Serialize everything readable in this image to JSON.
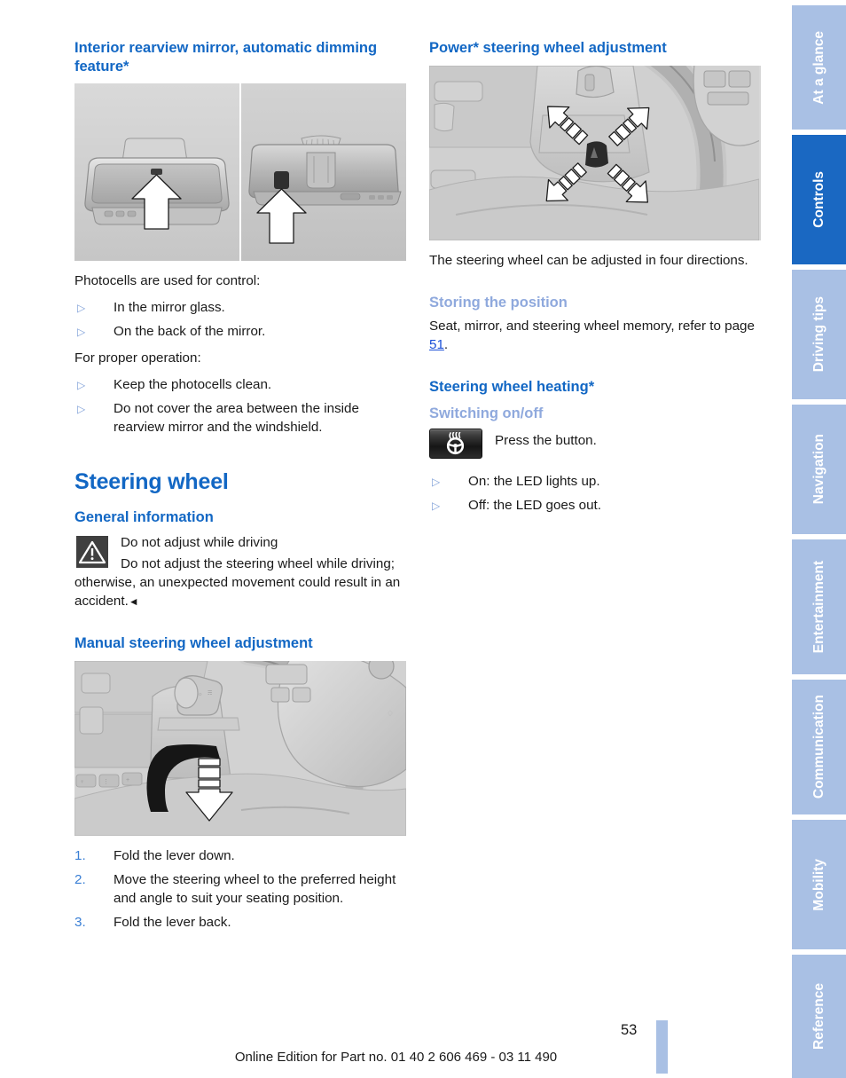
{
  "left_column": {
    "heading": "Interior rearview mirror, automatic dimming feature*",
    "figure_mirror": {
      "name": "interior-rearview-mirror-photocells",
      "caption": ""
    },
    "intro_1": "Photocells are used for control:",
    "bullets_1": [
      "In the mirror glass.",
      "On the back of the mirror."
    ],
    "intro_2": "For proper operation:",
    "bullets_2": [
      "Keep the photocells clean.",
      "Do not cover the area between the inside rearview mirror and the windshield."
    ],
    "section_title": "Steering wheel",
    "general_information_title": "General information",
    "warning": {
      "icon": "warning-triangle-icon",
      "title": "Do not adjust while driving",
      "body": "Do not adjust the steering wheel while driving; otherwise, an unexpected movement could result in an accident.",
      "end_mark": "◄"
    },
    "manual_adjustment_title": "Manual steering wheel adjustment",
    "figure_manual": {
      "name": "manual-steering-wheel-lever"
    },
    "steps": [
      {
        "num": "1.",
        "text": "Fold the lever down."
      },
      {
        "num": "2.",
        "text": "Move the steering wheel to the preferred height and angle to suit your seating posi­tion."
      },
      {
        "num": "3.",
        "text": "Fold the lever back."
      }
    ]
  },
  "right_column": {
    "heading": "Power* steering wheel adjustment",
    "figure_power": {
      "name": "power-steering-wheel-switch"
    },
    "paragraph_1": "The steering wheel can be adjusted in four di­rections.",
    "storing_title": "Storing the position",
    "storing_text_before": "Seat, mirror, and steering wheel memory, refer to page ",
    "storing_page_ref": "51",
    "storing_text_after": ".",
    "heating_title": "Steering wheel heating*",
    "switching_title": "Switching on/off",
    "button": {
      "icon": "steering-wheel-heating-icon",
      "caption": "Press the button."
    },
    "heating_bullets": [
      "On: the LED lights up.",
      "Off: the LED goes out."
    ]
  },
  "tabs": [
    {
      "label": "At a glance",
      "active": false
    },
    {
      "label": "Controls",
      "active": true
    },
    {
      "label": "Driving tips",
      "active": false
    },
    {
      "label": "Navigation",
      "active": false
    },
    {
      "label": "Entertainment",
      "active": false
    },
    {
      "label": "Communication",
      "active": false
    },
    {
      "label": "Mobility",
      "active": false
    },
    {
      "label": "Reference",
      "active": false
    }
  ],
  "footer": {
    "text": "Online Edition for Part no. 01 40 2 606 469 - 03 11 490",
    "page_number": "53"
  },
  "colors": {
    "heading_blue": "#1267c4",
    "sub_heading_blue": "#8fa9dd",
    "link_blue": "#1b50d8",
    "tab_active": "#1a68c2",
    "tab_inactive": "#a9c0e4",
    "bullet_marker": "#7fa0d8"
  }
}
